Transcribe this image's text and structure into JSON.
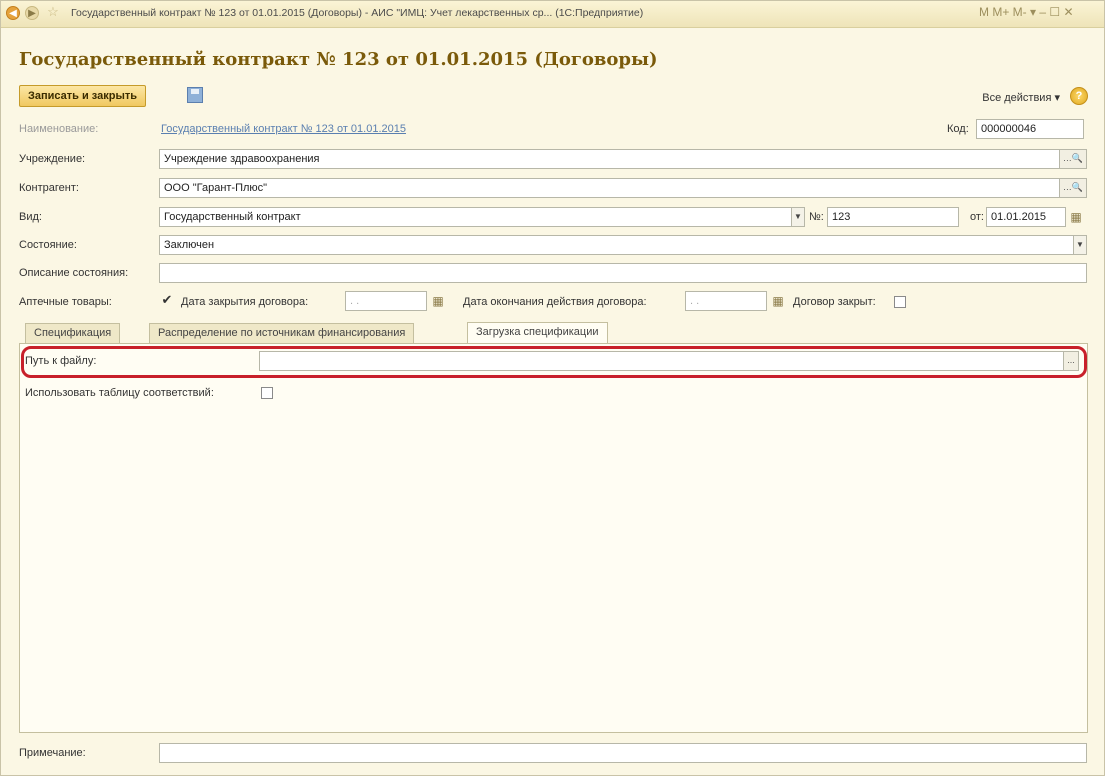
{
  "titlebar": {
    "title": "Государственный контракт № 123 от 01.01.2015 (Договоры) - АИС \"ИМЦ: Учет лекарственных ср... (1С:Предприятие)",
    "controls": "M  M+  M-  ▾  –  ☐  ✕"
  },
  "heading": "Государственный контракт № 123 от 01.01.2015 (Договоры)",
  "toolbar": {
    "save_close_label": "Записать и закрыть",
    "all_actions_label": "Все действия ▾",
    "help_label": "?"
  },
  "form": {
    "name_label": "Наименование:",
    "name_value": "Государственный контракт № 123 от 01.01.2015",
    "code_label": "Код:",
    "code_value": "000000046",
    "institution_label": "Учреждение:",
    "institution_value": "Учреждение здравоохранения",
    "contractor_label": "Контрагент:",
    "contractor_value": "ООО \"Гарант-Плюс\"",
    "kind_label": "Вид:",
    "kind_value": "Государственный контракт",
    "number_label": "№:",
    "number_value": "123",
    "date_label": "от:",
    "date_value": "01.01.2015",
    "state_label": "Состояние:",
    "state_value": "Заключен",
    "state_desc_label": "Описание состояния:",
    "state_desc_value": "",
    "pharmacy_label": "Аптечные товары:",
    "pharmacy_checked": true,
    "close_date_label": "Дата закрытия договора:",
    "close_date_value": ". .",
    "end_date_label": "Дата окончания действия договора:",
    "end_date_value": ". .",
    "closed_label": "Договор закрыт:",
    "note_label": "Примечание:",
    "note_value": ""
  },
  "tabs": [
    {
      "label": "Спецификация"
    },
    {
      "label": "Распределение по источникам финансирования"
    },
    {
      "label": "Загрузка спецификации"
    }
  ],
  "panel": {
    "file_path_label": "Путь к файлу:",
    "file_path_value": "",
    "browse_label": "...",
    "use_table_label": "Использовать таблицу соответствий:"
  },
  "colors": {
    "accent": "#7a5a0a",
    "highlight": "#c8202a",
    "background": "#fbf7e4"
  }
}
